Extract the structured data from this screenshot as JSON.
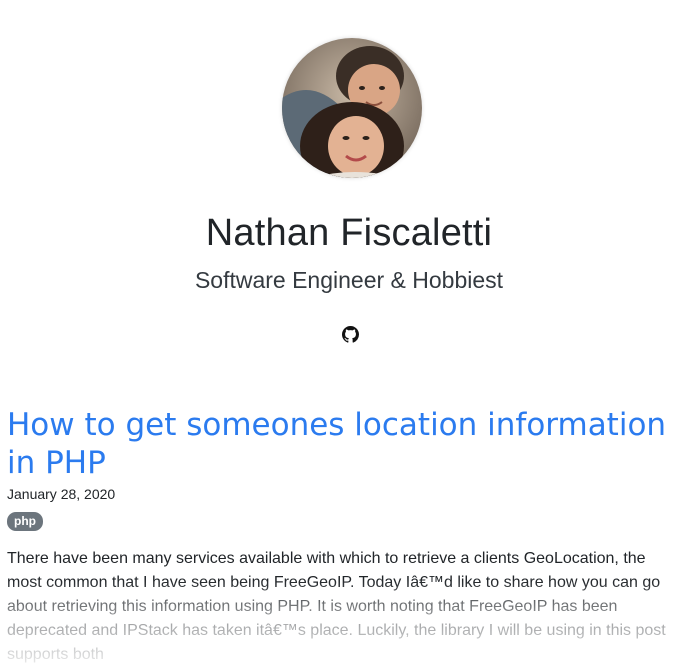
{
  "profile": {
    "name": "Nathan Fiscaletti",
    "tagline": "Software Engineer & Hobbiest",
    "avatar_icon": "profile-photo",
    "social_icon": "github-icon"
  },
  "post": {
    "title": "How to get someones location information in PHP",
    "date": "January 28, 2020",
    "tag": "php",
    "excerpt": "There have been many services available with which to retrieve a clients GeoLocation, the most common that I have seen being FreeGeoIP. Today Iâ€™d like to share how you can go about retrieving this information using PHP. It is worth noting that FreeGeoIP has been deprecated and IPStack has taken itâ€™s place. Luckily, the library I will be using in this post supports both"
  },
  "colors": {
    "link": "#2b7bef",
    "tag_bg": "#6c757d",
    "text": "#212529"
  }
}
